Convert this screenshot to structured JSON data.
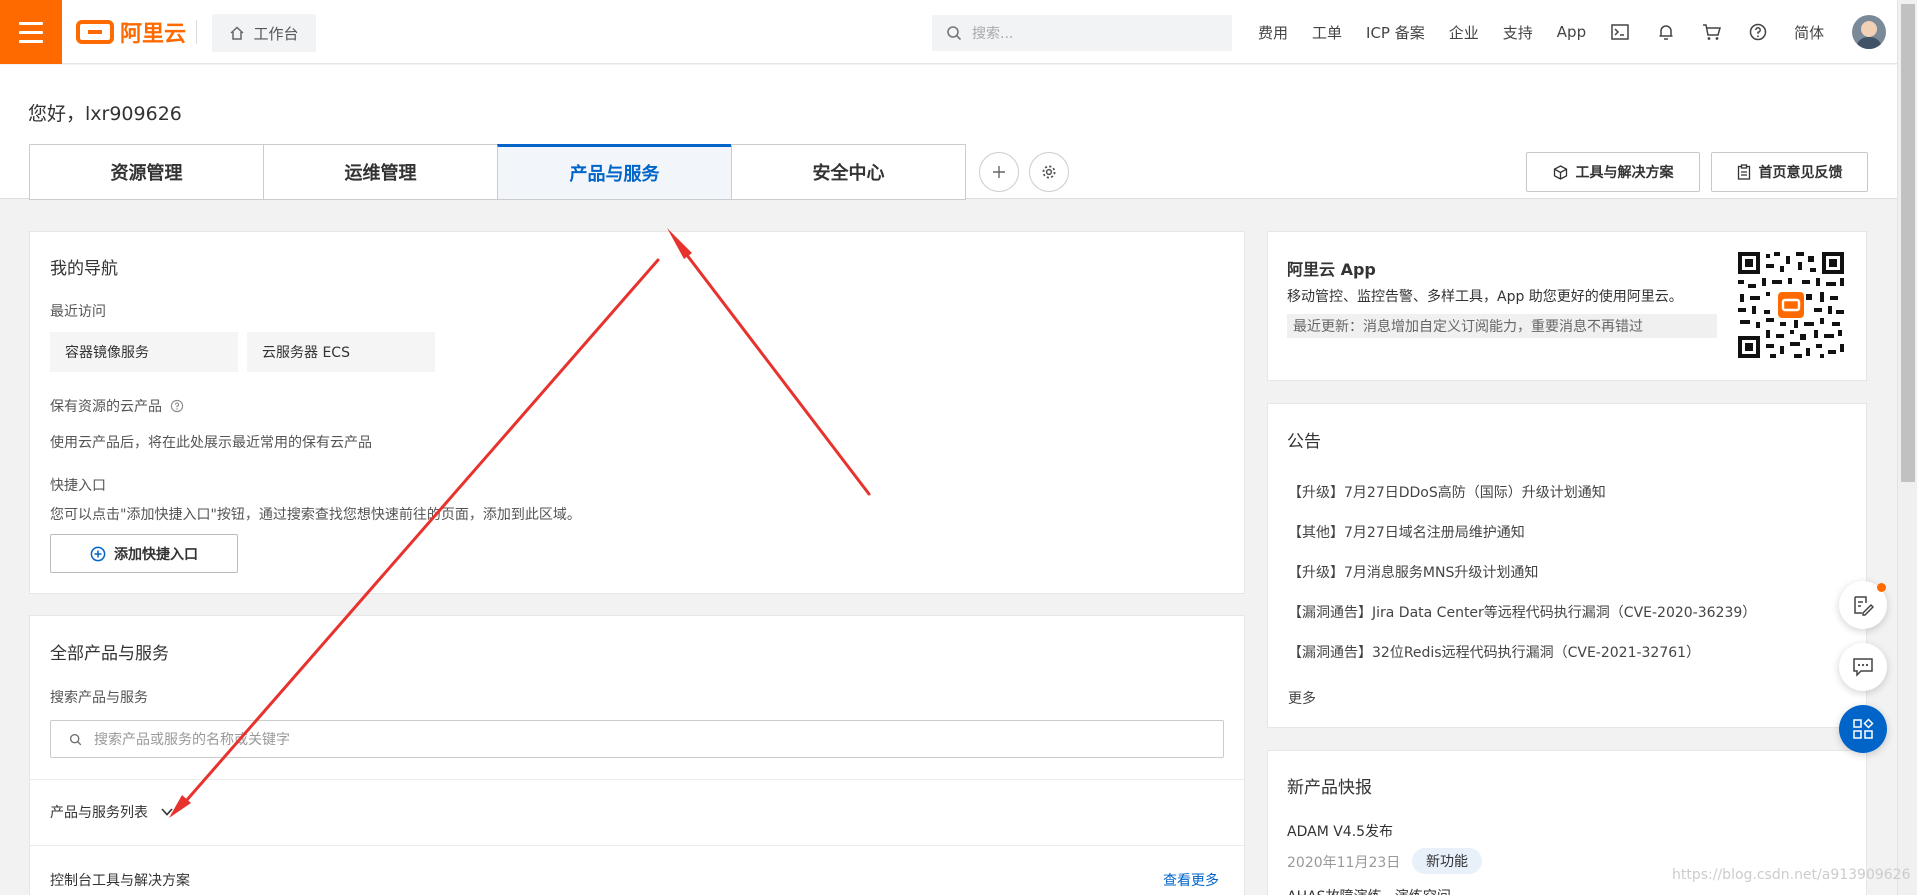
{
  "topbar": {
    "logo_text": "阿里云",
    "workbench_label": "工作台",
    "search_placeholder": "搜索...",
    "links": [
      "费用",
      "工单",
      "ICP 备案",
      "企业",
      "支持",
      "App"
    ],
    "language": "简体",
    "accent_color": "#ff6a00"
  },
  "greeting": "您好，lxr909626",
  "tabs": [
    "资源管理",
    "运维管理",
    "产品与服务",
    "安全中心"
  ],
  "active_tab": "产品与服务",
  "header_buttons": {
    "tools": "工具与解决方案",
    "feedback": "首页意见反馈"
  },
  "nav_card": {
    "title": "我的导航",
    "recent_label": "最近访问",
    "recent_items": [
      "容器镜像服务",
      "云服务器 ECS"
    ],
    "owned_label": "保有资源的云产品",
    "owned_desc": "使用云产品后，将在此处展示最近常用的保有云产品",
    "shortcut_label": "快捷入口",
    "shortcut_desc": "您可以点击\"添加快捷入口\"按钮，通过搜索查找您想快速前往的页面，添加到此区域。",
    "add_shortcut": "添加快捷入口"
  },
  "products_card": {
    "title": "全部产品与服务",
    "search_label": "搜索产品与服务",
    "search_placeholder": "搜索产品或服务的名称或关键字",
    "list_toggle": "产品与服务列表",
    "tools_label": "控制台工具与解决方案",
    "see_more": "查看更多"
  },
  "app_card": {
    "title": "阿里云 App",
    "desc": "移动管控、监控告警、多样工具，App 助您更好的使用阿里云。",
    "update": "最近更新：消息增加自定义订阅能力，重要消息不再错过"
  },
  "notice_card": {
    "title": "公告",
    "items": [
      "【升级】7月27日DDoS高防（国际）升级计划通知",
      "【其他】7月27日域名注册局维护通知",
      "【升级】7月消息服务MNS升级计划通知",
      "【漏洞通告】Jira Data Center等远程代码执行漏洞（CVE-2020-36239）",
      "【漏洞通告】32位Redis远程代码执行漏洞（CVE-2021-32761）"
    ],
    "more": "更多"
  },
  "news_card": {
    "title": "新产品快报",
    "item_title": "ADAM V4.5发布",
    "item_date": "2020年11月23日",
    "item_tag": "新功能",
    "next_item": "AHAS故障演练 · 演练空间"
  },
  "watermark": "https://blog.csdn.net/a913909626",
  "annotation_color": "#e8322e"
}
